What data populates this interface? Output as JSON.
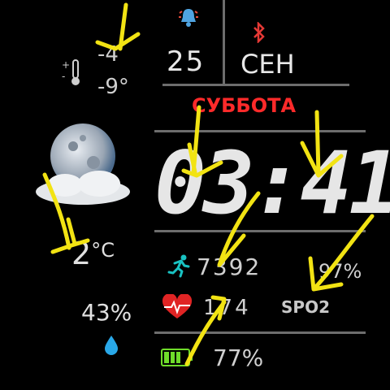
{
  "weather": {
    "temp_high": "-4",
    "temp_low": "-9°",
    "temp_current": "2",
    "temp_unit": "°C",
    "humidity": "43%",
    "icon": "moon-cloud-icon"
  },
  "date": {
    "day": "25",
    "month": "СЕН",
    "weekday": "СУББОТА"
  },
  "time": {
    "display": "03:41"
  },
  "health": {
    "steps": "7392",
    "heart_rate": "174",
    "spo2_value": "97%",
    "spo2_label": "SPO2"
  },
  "battery": {
    "level": "77%",
    "fill_fraction": 0.77
  },
  "status_icons": [
    "bell-icon",
    "bluetooth-icon"
  ],
  "colors": {
    "accent_red": "#ff2a2a",
    "battery_green": "#6fdc2a",
    "drop_blue": "#29a8e8",
    "runner_teal": "#19c2c2",
    "scribble_yellow": "#f2e313"
  }
}
